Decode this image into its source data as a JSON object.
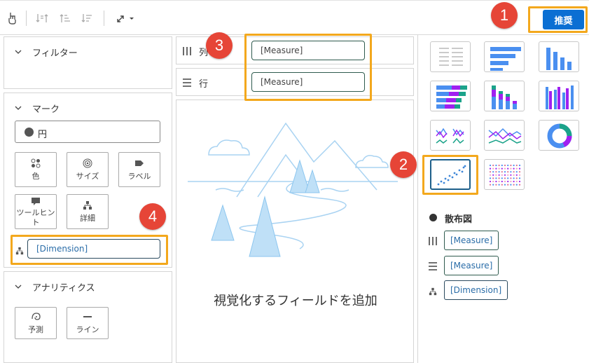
{
  "toolbar": {
    "icons": [
      "touch-icon",
      "swap-axes-icon",
      "sort-ascending-icon",
      "sort-descending-icon",
      "expand-icon"
    ],
    "recommend_label": "推奨"
  },
  "callouts": [
    "1",
    "2",
    "3",
    "4"
  ],
  "left_panel": {
    "filter": {
      "title": "フィルター"
    },
    "marks": {
      "title": "マーク",
      "mark_type": "円",
      "buttons": [
        {
          "label": "色",
          "icon": "color-icon"
        },
        {
          "label": "サイズ",
          "icon": "size-icon"
        },
        {
          "label": "ラベル",
          "icon": "label-icon"
        },
        {
          "label": "ツールヒント",
          "icon": "tooltip-icon"
        },
        {
          "label": "詳細",
          "icon": "detail-icon"
        }
      ],
      "detail_field": "[Dimension]"
    },
    "analytics": {
      "title": "アナリティクス",
      "buttons": [
        {
          "label": "予測",
          "icon": "forecast-icon"
        },
        {
          "label": "ライン",
          "icon": "line-icon"
        }
      ]
    }
  },
  "shelves": {
    "columns": {
      "label": "列",
      "field": "[Measure]"
    },
    "rows": {
      "label": "行",
      "field": "[Measure]"
    }
  },
  "canvas": {
    "placeholder": "視覚化するフィールドを追加"
  },
  "right_panel": {
    "chart_types": [
      "text-table",
      "horizontal-bar",
      "vertical-bar",
      "stacked-horizontal-bar",
      "stacked-vertical-bar",
      "grouped-bar",
      "multi-line-small",
      "line",
      "donut",
      "scatter",
      "heatmap"
    ],
    "selected": "scatter",
    "selected_title": "散布図",
    "fields": [
      {
        "icon": "columns-icon",
        "value": "[Measure]"
      },
      {
        "icon": "rows-icon",
        "value": "[Measure]"
      },
      {
        "icon": "detail-icon",
        "value": "[Dimension]"
      }
    ]
  },
  "colors": {
    "accent": "#0b6fd3",
    "highlight": "#f3a81d",
    "callout": "#e64537",
    "chart_blue": "#4a8ff0",
    "chart_purple": "#a020f0",
    "chart_teal": "#1ba38a"
  }
}
